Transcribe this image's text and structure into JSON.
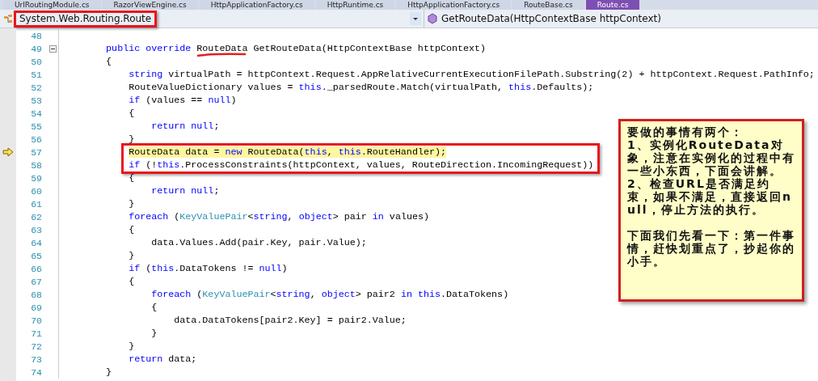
{
  "tabs": [
    {
      "label": "UrlRoutingModule.cs",
      "selected": false
    },
    {
      "label": "RazorViewEngine.cs",
      "selected": false
    },
    {
      "label": "HttpApplicationFactory.cs",
      "selected": false
    },
    {
      "label": "HttpRuntime.cs",
      "selected": false
    },
    {
      "label": "HttpApplicationFactory.cs",
      "selected": false
    },
    {
      "label": "RouteBase.cs",
      "selected": false
    },
    {
      "label": "Route.cs",
      "selected": true
    }
  ],
  "nav_bar": {
    "type_dropdown": "System.Web.Routing.Route",
    "member_dropdown": "GetRouteData(HttpContextBase httpContext)"
  },
  "code_lines": [
    {
      "number": "48",
      "current": false,
      "highlighted": false,
      "collapsible": false
    },
    {
      "number": "49",
      "current": false,
      "highlighted": false,
      "collapsible": true,
      "tokens": [
        {
          "kind": "kw",
          "text": "        public"
        },
        {
          "kind": "kw",
          "text": " override"
        },
        {
          "kind": "text",
          "text": " RouteData GetRouteData(HttpContextBase httpContext)"
        }
      ]
    },
    {
      "number": "50",
      "current": false,
      "highlighted": false,
      "collapsible": false,
      "tokens": [
        {
          "kind": "text",
          "text": "        {"
        }
      ]
    },
    {
      "number": "51",
      "current": false,
      "highlighted": false,
      "collapsible": false,
      "tokens": [
        {
          "kind": "kw",
          "text": "            string"
        },
        {
          "kind": "text",
          "text": " virtualPath = httpContext.Request.AppRelativeCurrentExecutionFilePath.Substring(2) + httpContext.Request.PathInfo;"
        }
      ]
    },
    {
      "number": "52",
      "current": false,
      "highlighted": false,
      "collapsible": false,
      "tokens": [
        {
          "kind": "text",
          "text": "            RouteValueDictionary values = "
        },
        {
          "kind": "kw",
          "text": "this"
        },
        {
          "kind": "text",
          "text": "._parsedRoute.Match(virtualPath, "
        },
        {
          "kind": "kw",
          "text": "this"
        },
        {
          "kind": "text",
          "text": ".Defaults);"
        }
      ]
    },
    {
      "number": "53",
      "current": false,
      "highlighted": false,
      "collapsible": false,
      "tokens": [
        {
          "kind": "kw",
          "text": "            if"
        },
        {
          "kind": "text",
          "text": " (values == "
        },
        {
          "kind": "kw",
          "text": "null"
        },
        {
          "kind": "text",
          "text": ")"
        }
      ]
    },
    {
      "number": "54",
      "current": false,
      "highlighted": false,
      "collapsible": false,
      "tokens": [
        {
          "kind": "text",
          "text": "            {"
        }
      ]
    },
    {
      "number": "55",
      "current": false,
      "highlighted": false,
      "collapsible": false,
      "tokens": [
        {
          "kind": "kw",
          "text": "                return"
        },
        {
          "kind": "kw",
          "text": " null"
        },
        {
          "kind": "text",
          "text": ";"
        }
      ]
    },
    {
      "number": "56",
      "current": false,
      "highlighted": false,
      "collapsible": false,
      "tokens": [
        {
          "kind": "text",
          "text": "            }"
        }
      ]
    },
    {
      "number": "57",
      "current": true,
      "highlighted": true,
      "collapsible": false,
      "tokens": [
        {
          "kind": "text",
          "text": "            RouteData data = "
        },
        {
          "kind": "kw",
          "text": "new"
        },
        {
          "kind": "text",
          "text": " RouteData("
        },
        {
          "kind": "kw",
          "text": "this"
        },
        {
          "kind": "text",
          "text": ", "
        },
        {
          "kind": "kw",
          "text": "this"
        },
        {
          "kind": "text",
          "text": ".RouteHandler);"
        }
      ]
    },
    {
      "number": "58",
      "current": false,
      "highlighted": false,
      "collapsible": false,
      "tokens": [
        {
          "kind": "kw",
          "text": "            if"
        },
        {
          "kind": "text",
          "text": " (!"
        },
        {
          "kind": "kw",
          "text": "this"
        },
        {
          "kind": "text",
          "text": ".ProcessConstraints(httpContext, values, RouteDirection.IncomingRequest))"
        }
      ]
    },
    {
      "number": "59",
      "current": false,
      "highlighted": false,
      "collapsible": false,
      "tokens": [
        {
          "kind": "text",
          "text": "            {"
        }
      ]
    },
    {
      "number": "60",
      "current": false,
      "highlighted": false,
      "collapsible": false,
      "tokens": [
        {
          "kind": "kw",
          "text": "                return"
        },
        {
          "kind": "kw",
          "text": " null"
        },
        {
          "kind": "text",
          "text": ";"
        }
      ]
    },
    {
      "number": "61",
      "current": false,
      "highlighted": false,
      "collapsible": false,
      "tokens": [
        {
          "kind": "text",
          "text": "            }"
        }
      ]
    },
    {
      "number": "62",
      "current": false,
      "highlighted": false,
      "collapsible": false,
      "tokens": [
        {
          "kind": "kw",
          "text": "            foreach"
        },
        {
          "kind": "text",
          "text": " ("
        },
        {
          "kind": "type",
          "text": "KeyValuePair"
        },
        {
          "kind": "text",
          "text": "<"
        },
        {
          "kind": "kw",
          "text": "string"
        },
        {
          "kind": "text",
          "text": ", "
        },
        {
          "kind": "kw",
          "text": "object"
        },
        {
          "kind": "text",
          "text": "> pair "
        },
        {
          "kind": "kw",
          "text": "in"
        },
        {
          "kind": "text",
          "text": " values)"
        }
      ]
    },
    {
      "number": "63",
      "current": false,
      "highlighted": false,
      "collapsible": false,
      "tokens": [
        {
          "kind": "text",
          "text": "            {"
        }
      ]
    },
    {
      "number": "64",
      "current": false,
      "highlighted": false,
      "collapsible": false,
      "tokens": [
        {
          "kind": "text",
          "text": "                data.Values.Add(pair.Key, pair.Value);"
        }
      ]
    },
    {
      "number": "65",
      "current": false,
      "highlighted": false,
      "collapsible": false,
      "tokens": [
        {
          "kind": "text",
          "text": "            }"
        }
      ]
    },
    {
      "number": "66",
      "current": false,
      "highlighted": false,
      "collapsible": false,
      "tokens": [
        {
          "kind": "kw",
          "text": "            if"
        },
        {
          "kind": "text",
          "text": " ("
        },
        {
          "kind": "kw",
          "text": "this"
        },
        {
          "kind": "text",
          "text": ".DataTokens != "
        },
        {
          "kind": "kw",
          "text": "null"
        },
        {
          "kind": "text",
          "text": ")"
        }
      ]
    },
    {
      "number": "67",
      "current": false,
      "highlighted": false,
      "collapsible": false,
      "tokens": [
        {
          "kind": "text",
          "text": "            {"
        }
      ]
    },
    {
      "number": "68",
      "current": false,
      "highlighted": false,
      "collapsible": false,
      "tokens": [
        {
          "kind": "kw",
          "text": "                foreach"
        },
        {
          "kind": "text",
          "text": " ("
        },
        {
          "kind": "type",
          "text": "KeyValuePair"
        },
        {
          "kind": "text",
          "text": "<"
        },
        {
          "kind": "kw",
          "text": "string"
        },
        {
          "kind": "text",
          "text": ", "
        },
        {
          "kind": "kw",
          "text": "object"
        },
        {
          "kind": "text",
          "text": "> pair2 "
        },
        {
          "kind": "kw",
          "text": "in"
        },
        {
          "kind": "kw",
          "text": " this"
        },
        {
          "kind": "text",
          "text": ".DataTokens)"
        }
      ]
    },
    {
      "number": "69",
      "current": false,
      "highlighted": false,
      "collapsible": false,
      "tokens": [
        {
          "kind": "text",
          "text": "                {"
        }
      ]
    },
    {
      "number": "70",
      "current": false,
      "highlighted": false,
      "collapsible": false,
      "tokens": [
        {
          "kind": "text",
          "text": "                    data.DataTokens[pair2.Key] = pair2.Value;"
        }
      ]
    },
    {
      "number": "71",
      "current": false,
      "highlighted": false,
      "collapsible": false,
      "tokens": [
        {
          "kind": "text",
          "text": "                }"
        }
      ]
    },
    {
      "number": "72",
      "current": false,
      "highlighted": false,
      "collapsible": false,
      "tokens": [
        {
          "kind": "text",
          "text": "            }"
        }
      ]
    },
    {
      "number": "73",
      "current": false,
      "highlighted": false,
      "collapsible": false,
      "tokens": [
        {
          "kind": "kw",
          "text": "            return"
        },
        {
          "kind": "text",
          "text": " data;"
        }
      ]
    },
    {
      "number": "74",
      "current": false,
      "highlighted": false,
      "collapsible": false,
      "tokens": [
        {
          "kind": "text",
          "text": "        }"
        }
      ]
    }
  ],
  "note": {
    "paragraphs": [
      "要做的事情有两个：",
      "1、实例化RouteData对象，注意在实例化的过程中有一些小东西，下面会讲解。",
      "2、检查URL是否满足约束，如果不满足，直接返回null，停止方法的执行。",
      "下面我们先看一下：第一件事情，赶快划重点了，抄起你的小手。"
    ]
  }
}
